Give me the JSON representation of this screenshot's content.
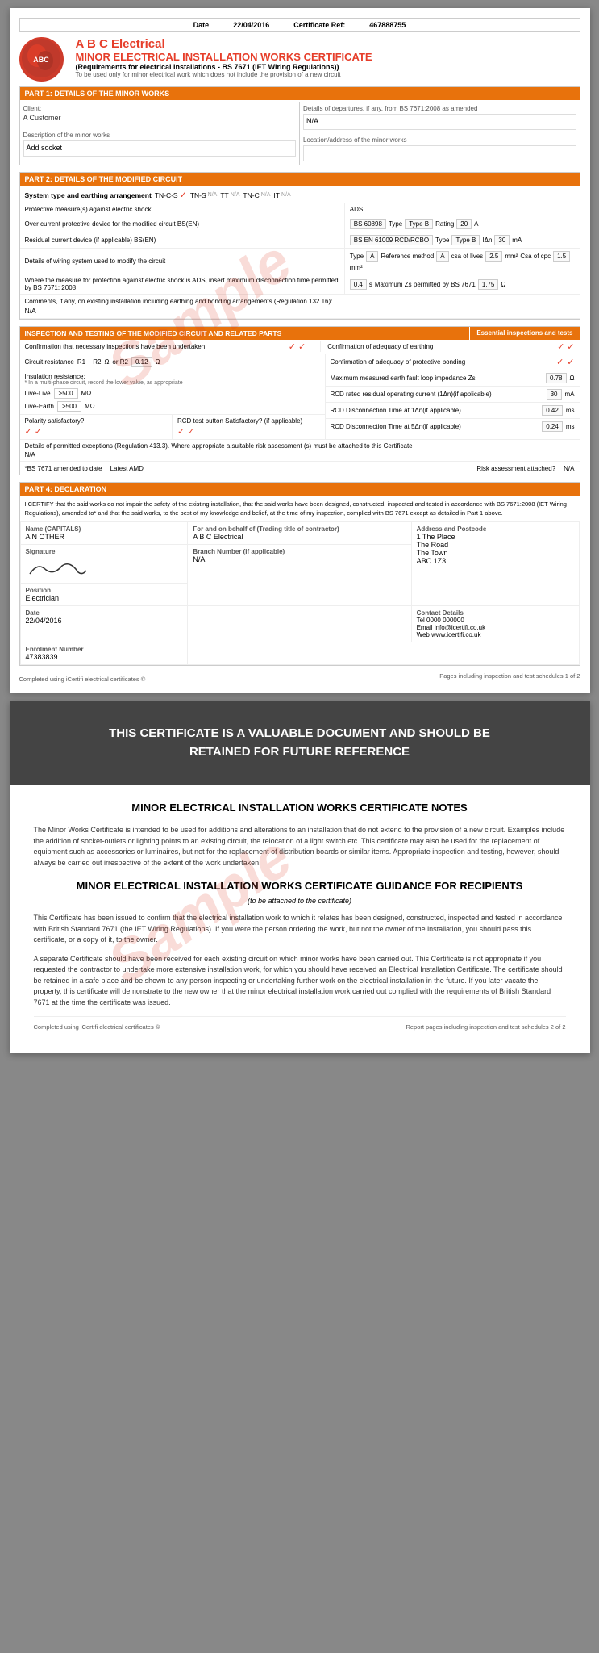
{
  "page1": {
    "date_label": "Date",
    "date_value": "22/04/2016",
    "cert_ref_label": "Certificate Ref:",
    "cert_ref_value": "467888755",
    "company": "A B C Electrical",
    "title": "MINOR ELECTRICAL INSTALLATION WORKS CERTIFICATE",
    "subtitle": "(Requirements for electrical installations - BS 7671 (IET Wiring Regulations))",
    "usage_note": "To be used only for minor electrical work which does not include the provision of a new circuit",
    "part1_header": "PART 1: DETAILS OF THE MINOR WORKS",
    "part1_departures_label": "Details of departures, if any, from BS 7671:2008 as amended",
    "part1_departures_value": "N/A",
    "client_label": "Client:",
    "client_value": "A Customer",
    "desc_label": "Description of the minor works",
    "desc_value": "Add socket",
    "location_label": "Location/address of the minor works",
    "location_value": "",
    "part2_header": "PART 2: DETAILS OF THE MODIFIED CIRCUIT",
    "system_label": "System type and earthing arrangement",
    "tncs_label": "TN-C-S",
    "tns_label": "TN-S",
    "tns_na": "N/A",
    "tt_label": "TT",
    "tt_na": "N/A",
    "tnc_label": "TN-C",
    "tnc_na": "N/A",
    "it_label": "IT",
    "it_na": "N/A",
    "protective_label": "Protective measure(s) against electric shock",
    "protective_value": "ADS",
    "overcurrent_label": "Over current protective device for the modified circuit BS(EN)",
    "overcurrent_bs": "BS 60898",
    "type_label": "Type",
    "type_value": "Type B",
    "rating_label": "Rating",
    "rating_value": "20",
    "rating_unit": "A",
    "rcd_label": "Residual current device (if applicable) BS(EN)",
    "rcd_bs": "BS EN 61009 RCD/RCBO",
    "rcd_type_label": "Type",
    "rcd_type_value": "Type B",
    "idn_label": "IΔn",
    "idn_value": "30",
    "idn_unit": "mA",
    "wiring_label": "Details of wiring system used to modify the circuit",
    "wiring_type": "Type",
    "wiring_type_val": "A",
    "ref_method_label": "Reference method",
    "ref_method_val": "A",
    "csa_lives_label": "csa of lives",
    "csa_lives_val": "2.5",
    "csa_lives_unit": "mm²",
    "csa_cpc_label": "Csa of cpc",
    "csa_cpc_val": "1.5",
    "csa_cpc_unit": "mm²",
    "protection_label": "Where the measure for protection against electric shock is ADS, insert maximum disconnection time permitted by BS 7671: 2008",
    "protection_val": "0.4",
    "protection_unit": "s",
    "max_zs_label": "Maximum Zs permitted by BS 7671",
    "max_zs_val": "1.75",
    "max_zs_unit": "Ω",
    "comments_label": "Comments, if any, on existing installation including earthing and bonding arrangements (Regulation 132.16):",
    "comments_value": "N/A",
    "part3_header": "INSPECTION AND TESTING OF THE MODIFIED CIRCUIT AND RELATED PARTS",
    "part3_essential": "Essential inspections and tests",
    "insp1_label": "Confirmation that necessary inspections have been undertaken",
    "insp1_check1": "✓",
    "insp1_check2": "✓",
    "insp_earthing_label": "Confirmation of adequacy of earthing",
    "insp_earthing_c1": "✓",
    "insp_earthing_c2": "✓",
    "circuit_res_label": "Circuit resistance",
    "r1r2_label": "R1 + R2",
    "r1r2_unit": "Ω",
    "or_r2_label": "or R2",
    "r1r2_val": "0.12",
    "r2_unit": "Ω",
    "bonding_label": "Confirmation of adequacy of protective bonding",
    "bonding_c1": "✓",
    "bonding_c2": "✓",
    "insul_label": "Insulation resistance:",
    "insul_note": "* In a multi-phase circuit, record the lower value, as appropriate",
    "polarity_label": "Polarity satisfactory?",
    "polarity_c1": "✓",
    "polarity_c2": "✓",
    "rcd_test_label": "RCD test button Satisfactory? (if applicable)",
    "rcd_test_c1": "✓",
    "rcd_test_c2": "✓",
    "earth_fault_label": "Maximum measured earth fault loop impedance Zs",
    "earth_fault_val": "0.78",
    "earth_fault_unit": "Ω",
    "live_live_label": "Live-Live",
    "live_live_val": ">500",
    "live_live_unit": "MΩ",
    "rcd_rated_label": "RCD rated residual operating current (1Δn)(if applicable)",
    "rcd_rated_val": "30",
    "rcd_rated_unit": "mA",
    "live_earth_label": "Live-Earth",
    "live_earth_val": ">500",
    "live_earth_unit": "MΩ",
    "rcd_disc_1_label": "RCD Disconnection Time at 1Δn(if applicable)",
    "rcd_disc_1_val": "0.42",
    "rcd_disc_1_unit": "ms",
    "rcd_disc_5_label": "RCD Disconnection Time at 5Δn(if applicable)",
    "rcd_disc_5_val": "0.24",
    "rcd_disc_5_unit": "ms",
    "permitted_note": "Details of permitted exceptions (Regulation 413.3). Where appropriate a suitable risk assessment (s) must be attached to this Certificate",
    "permitted_value": "N/A",
    "bs7671_label": "*BS 7671 amended to date",
    "latest_amd_label": "Latest AMD",
    "risk_label": "Risk assessment attached?",
    "risk_value": "N/A",
    "part4_header": "PART 4: DECLARATION",
    "declaration_text": "I CERTIFY that the said works do not impair the safety of the existing installation, that the said works have been designed, constructed, inspected and tested in accordance with BS 7671:2008 (IET Wiring Regulations), amended to* and that the said works, to the best of my knowledge and belief, at the time of my inspection, complied with BS 7671 except as detailed in Part 1 above.",
    "name_label": "Name (CAPITALS)",
    "name_value": "A N OTHER",
    "for_label": "For and on behalf of (Trading title of contractor)",
    "for_value": "A B C Electrical",
    "sig_label": "Signature",
    "address_label": "Address and Postcode",
    "address_value": "1 The Place\nThe Road\nThe Town\nABC 1Z3",
    "position_label": "Position",
    "position_value": "Electrician",
    "date_label2": "Date",
    "date_value2": "22/04/2016",
    "branch_label": "Branch Number (if applicable)",
    "branch_value": "N/A",
    "enrolment_label": "Enrolment Number",
    "enrolment_value": "47383839",
    "contact_label": "Contact Details",
    "tel_label": "Tel",
    "tel_value": "0000 000000",
    "email_label": "Email",
    "email_value": "info@icertifi.co.uk",
    "web_label": "Web",
    "web_value": "www.icertifi.co.uk",
    "footer_left": "Completed using iCertifi electrical certificates ©",
    "footer_right": "Pages including inspection and test schedules 1 of 2",
    "sample_watermark": "Sample"
  },
  "page2": {
    "banner_text": "THIS CERTIFICATE IS A VALUABLE DOCUMENT AND SHOULD BE\nRETAINED FOR FUTURE REFERENCE",
    "notes_title": "MINOR ELECTRICAL INSTALLATION WORKS CERTIFICATE NOTES",
    "notes_body": "The Minor Works Certificate is intended to be used for additions and alterations to an installation that do not extend to the provision of a new circuit. Examples include the addition of socket-outlets or lighting points to an existing circuit, the relocation of a light switch etc. This certificate may also be used for the replacement of equipment such as accessories or luminaires, but not for the replacement of distribution boards or similar items. Appropriate inspection and testing, however, should always be carried out irrespective of the extent of the work undertaken.",
    "guidance_title": "MINOR ELECTRICAL INSTALLATION WORKS CERTIFICATE GUIDANCE FOR RECIPIENTS",
    "guidance_subtitle": "(to be attached to the certificate)",
    "guidance_body1": "This Certificate has been issued to confirm that the electrical installation work to which it relates has been designed, constructed, inspected and tested in accordance with British Standard 7671 (the IET Wiring Regulations). If you were the person ordering the work, but not the owner of the installation, you should pass this certificate, or a copy of it, to the owner.",
    "guidance_body2": "A separate Certificate should have been received for each existing circuit on which minor works have been carried out. This Certificate is not appropriate if you requested the contractor to undertake more extensive installation work, for which you should have received an Electrical Installation Certificate. The certificate should be retained in a safe place and be shown to any person inspecting or undertaking further work on the electrical installation in the future. If you later vacate the property, this certificate will demonstrate to the new owner that the minor electrical installation work carried out complied with the requirements of British Standard 7671 at the time the certificate was issued.",
    "footer_left": "Completed using iCertifi electrical certificates ©",
    "footer_right": "Report pages including inspection and test schedules 2 of 2",
    "sample_watermark": "Sample"
  }
}
